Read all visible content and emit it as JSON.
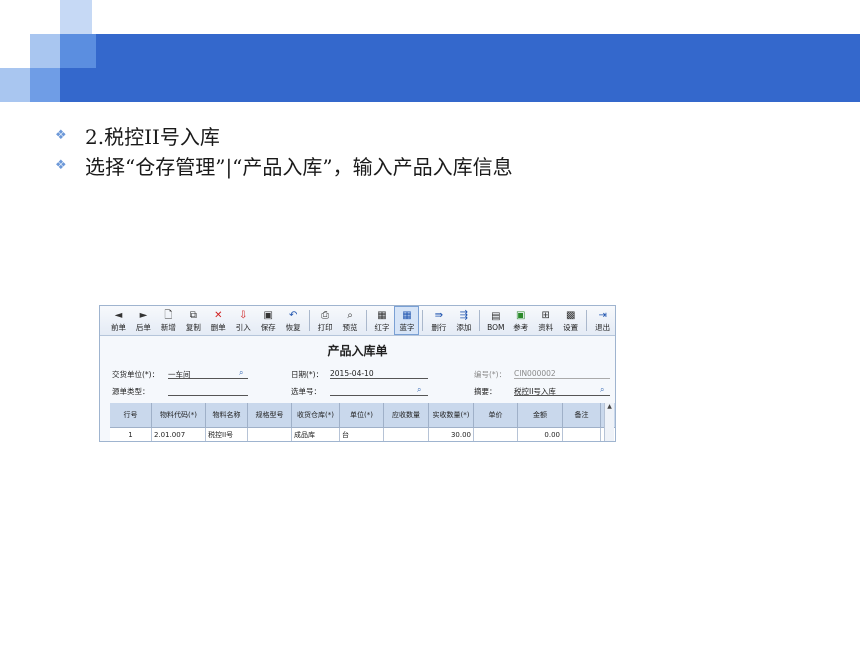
{
  "slide": {
    "bullets": [
      {
        "text": "2.税控II号入库"
      },
      {
        "text": "选择“仓存管理”|“产品入库”，输入产品入库信息"
      }
    ]
  },
  "app": {
    "toolbar": [
      {
        "label": "前单",
        "icon": "prev-arrow-icon",
        "glyph": "◄"
      },
      {
        "label": "后单",
        "icon": "next-arrow-icon",
        "glyph": "►"
      },
      {
        "label": "新增",
        "icon": "new-document-icon",
        "glyph": "🗋"
      },
      {
        "label": "复制",
        "icon": "copy-icon",
        "glyph": "⧉"
      },
      {
        "label": "删单",
        "icon": "delete-icon",
        "glyph": "✕"
      },
      {
        "label": "引入",
        "icon": "import-icon",
        "glyph": "⇩"
      },
      {
        "label": "保存",
        "icon": "save-icon",
        "glyph": "▣"
      },
      {
        "label": "恢复",
        "icon": "undo-icon",
        "glyph": "↶"
      },
      {
        "label": "打印",
        "icon": "print-icon",
        "glyph": "⎙"
      },
      {
        "label": "预览",
        "icon": "preview-icon",
        "glyph": "⌕"
      },
      {
        "label": "红字",
        "icon": "red-text-icon",
        "glyph": "▦"
      },
      {
        "label": "蓝字",
        "icon": "blue-text-icon",
        "glyph": "▦"
      },
      {
        "label": "删行",
        "icon": "delete-row-icon",
        "glyph": "⇛"
      },
      {
        "label": "添加",
        "icon": "add-row-icon",
        "glyph": "⇶"
      },
      {
        "label": "BOM",
        "icon": "bom-icon",
        "glyph": "▤"
      },
      {
        "label": "参考",
        "icon": "reference-icon",
        "glyph": "▣"
      },
      {
        "label": "资料",
        "icon": "data-icon",
        "glyph": "⊞"
      },
      {
        "label": "设置",
        "icon": "settings-icon",
        "glyph": "▩"
      },
      {
        "label": "退出",
        "icon": "exit-icon",
        "glyph": "⇥"
      }
    ],
    "form": {
      "title": "产品入库单",
      "dept_label": "交货单位(*)：",
      "dept_value": "一车间",
      "date_label": "日期(*)：",
      "date_value": "2015-04-10",
      "no_label": "编号(*)：",
      "no_value": "CIN000002",
      "src_type_label": "源单类型：",
      "src_type_value": "",
      "src_no_label": "选单号：",
      "src_no_value": "",
      "memo_label": "摘要：",
      "memo_value": "税控II号入库"
    },
    "grid": {
      "headers": [
        "行号",
        "物料代码(*)",
        "物料名称",
        "规格型号",
        "收货仓库(*)",
        "单位(*)",
        "应收数量",
        "实收数量(*)",
        "单价",
        "金额",
        "备注"
      ],
      "rows": [
        [
          "1",
          "2.01.007",
          "税控II号",
          "",
          "成品库",
          "台",
          "",
          "30.00",
          "",
          "0.00",
          ""
        ]
      ]
    },
    "colors": {
      "banner": "#3468cc",
      "grid_header": "#c9d8ec",
      "active_button": "#d6e4f7"
    }
  }
}
